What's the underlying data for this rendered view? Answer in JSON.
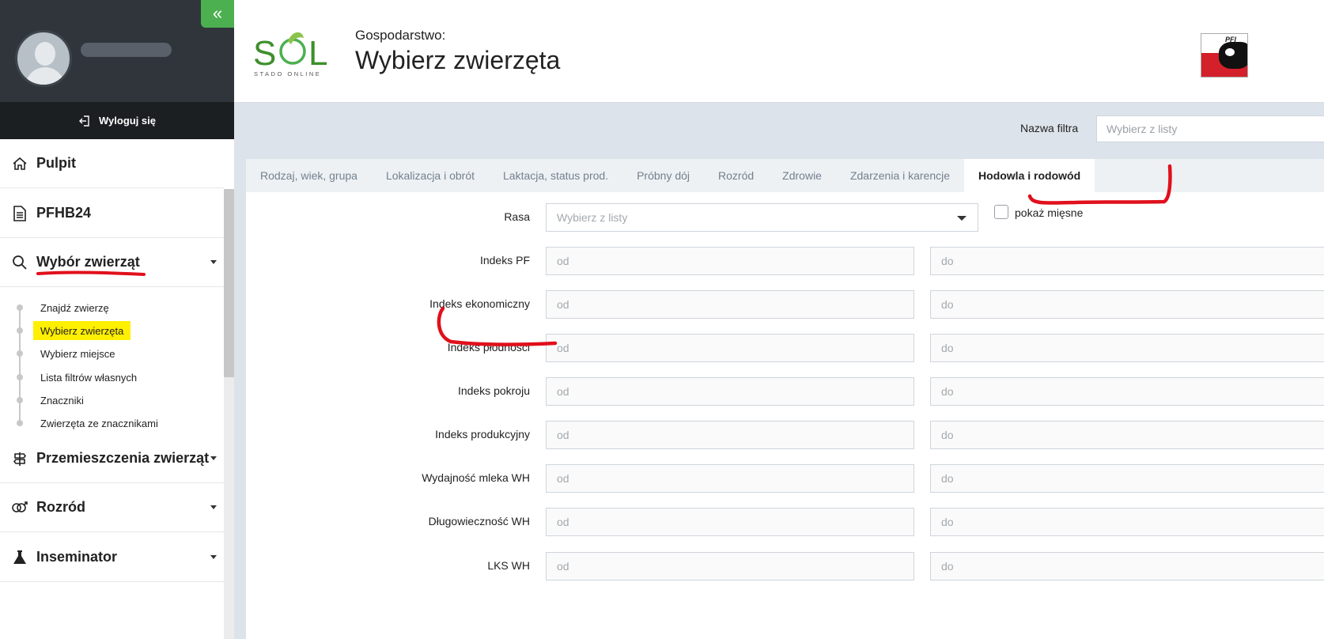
{
  "sidebar": {
    "collapse_icon": "«",
    "logout_label": "Wyloguj się",
    "menu": [
      {
        "label": "Pulpit",
        "icon": "home-icon"
      },
      {
        "label": "PFHB24",
        "icon": "document-icon"
      },
      {
        "label": "Wybór zwierząt",
        "icon": "search-icon"
      },
      {
        "label": "Przemieszczenia zwierząt",
        "icon": "signpost-icon"
      },
      {
        "label": "Rozród",
        "icon": "gender-icon"
      },
      {
        "label": "Inseminator",
        "icon": "flask-icon"
      }
    ],
    "submenu": [
      {
        "label": "Znajdź zwierzę"
      },
      {
        "label": "Wybierz zwierzęta",
        "active": true
      },
      {
        "label": "Wybierz miejsce"
      },
      {
        "label": "Lista filtrów własnych"
      },
      {
        "label": "Znaczniki"
      },
      {
        "label": "Zwierzęta ze znacznikami"
      }
    ]
  },
  "header": {
    "logo_text": "STADO ONLINE",
    "farm_label": "Gospodarstwo:",
    "title": "Wybierz zwierzęta",
    "badge_text": "PFI"
  },
  "filter": {
    "label": "Nazwa filtra",
    "placeholder": "Wybierz z listy"
  },
  "tabs": [
    {
      "label": "Rodzaj, wiek, grupa"
    },
    {
      "label": "Lokalizacja i obrót"
    },
    {
      "label": "Laktacja, status prod."
    },
    {
      "label": "Próbny dój"
    },
    {
      "label": "Rozród"
    },
    {
      "label": "Zdrowie"
    },
    {
      "label": "Zdarzenia i karencje"
    },
    {
      "label": "Hodowla i rodowód",
      "active": true
    }
  ],
  "form": {
    "rasa_label": "Rasa",
    "rasa_placeholder": "Wybierz z listy",
    "meat_checkbox_label": "pokaż mięsne",
    "from_placeholder": "od",
    "to_placeholder": "do",
    "rows": [
      {
        "label": "Indeks PF"
      },
      {
        "label": "Indeks ekonomiczny"
      },
      {
        "label": "Indeks płodności"
      },
      {
        "label": "Indeks pokroju"
      },
      {
        "label": "Indeks produkcyjny"
      },
      {
        "label": "Wydajność mleka WH"
      },
      {
        "label": "Długowieczność WH"
      },
      {
        "label": "LKS WH"
      }
    ]
  },
  "colors": {
    "sidebar_dark": "#2f353a",
    "accent_green": "#4caf50",
    "highlight_yellow": "#ffef00",
    "annotation_red": "#e0101c",
    "main_bg": "#dde3ea"
  }
}
